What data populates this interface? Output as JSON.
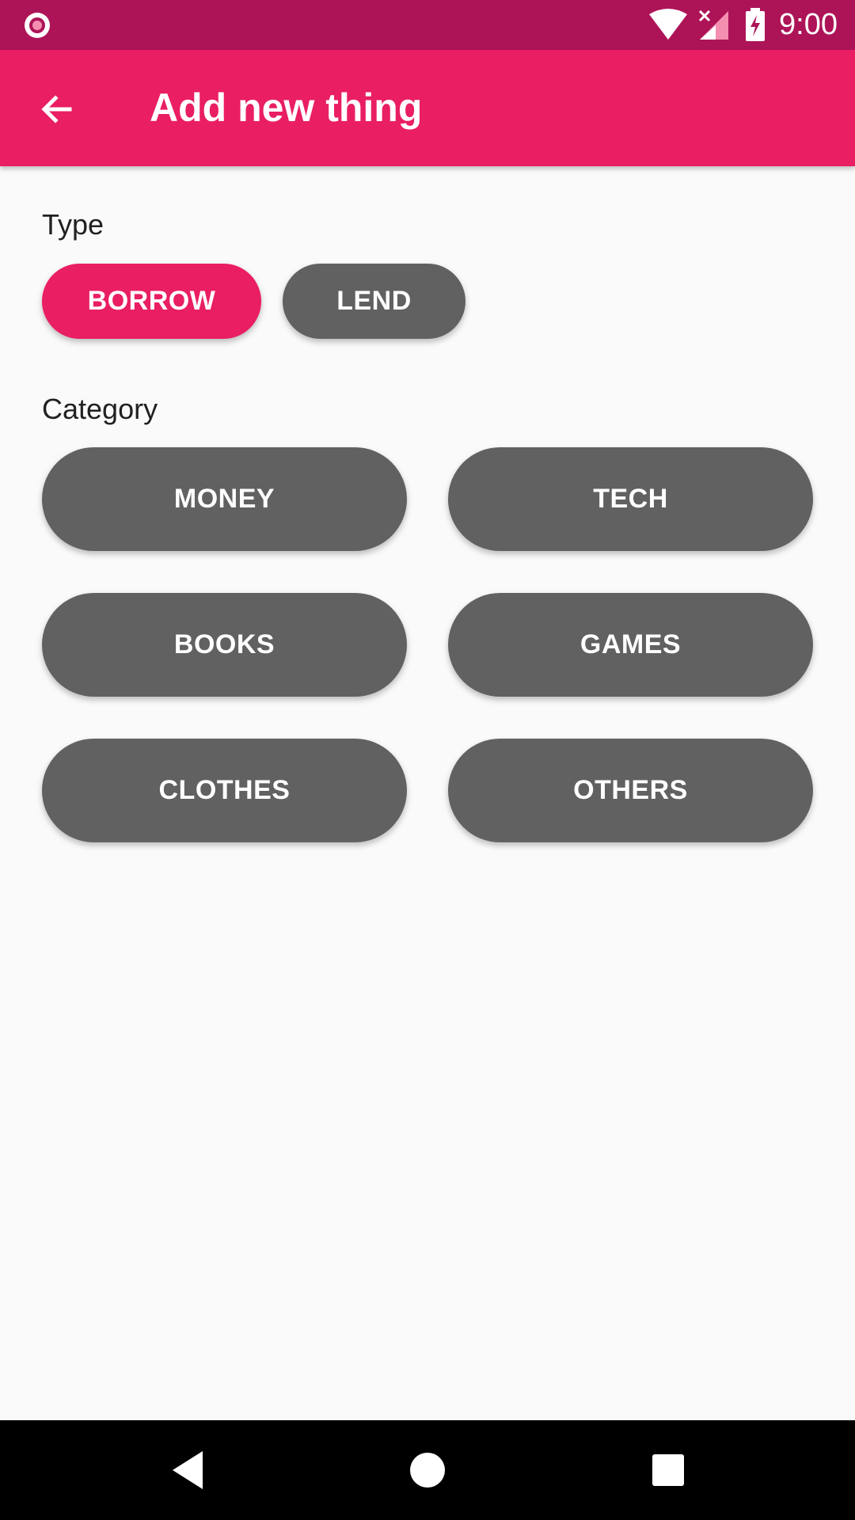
{
  "status_bar": {
    "time": "9:00",
    "icons": [
      "notification-circle-icon",
      "wifi-icon",
      "signal-icon",
      "battery-charging-icon"
    ]
  },
  "app_bar": {
    "title": "Add new thing",
    "back_icon": "arrow-back-icon"
  },
  "type_section": {
    "label": "Type",
    "options": [
      {
        "label": "BORROW",
        "selected": true
      },
      {
        "label": "LEND",
        "selected": false
      }
    ]
  },
  "category_section": {
    "label": "Category",
    "options": [
      {
        "label": "MONEY",
        "selected": false
      },
      {
        "label": "TECH",
        "selected": false
      },
      {
        "label": "BOOKS",
        "selected": false
      },
      {
        "label": "GAMES",
        "selected": false
      },
      {
        "label": "CLOTHES",
        "selected": false
      },
      {
        "label": "OTHERS",
        "selected": false
      }
    ]
  },
  "nav_bar": {
    "icons": [
      "nav-back-icon",
      "nav-home-icon",
      "nav-recents-icon"
    ]
  },
  "colors": {
    "status_bar": "#AD1457",
    "primary": "#E91E63",
    "unselected_button": "#616161",
    "background": "#FAFAFA"
  }
}
